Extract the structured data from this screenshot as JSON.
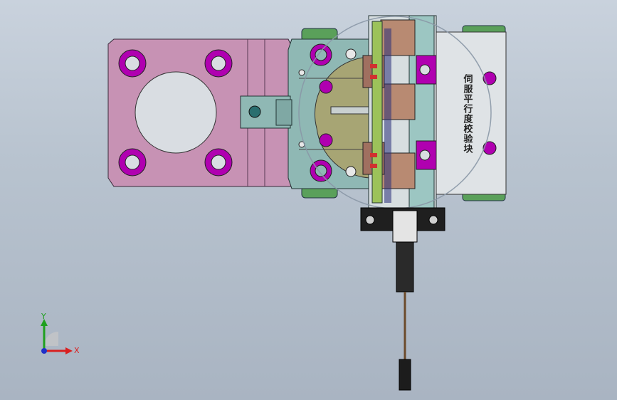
{
  "viewport": {
    "part_label": "伺服平行度校验块",
    "colors": {
      "background_top": "#c9d2dd",
      "background_bottom": "#a9b4c2",
      "mount_plate": "#c792b4",
      "mount_bore": "#d9dde2",
      "bolt_head": "#b000b0",
      "bracket": "#8fb8b4",
      "guide_block": "#d7dee0",
      "rail": "#5aa05a",
      "flange": "#a7a574",
      "connector_body": "#b88a72",
      "connector_green": "#9cc25a",
      "cable": "#6b4a2a",
      "cable_plug": "#1c1c1c"
    }
  },
  "triad": {
    "x_label": "X",
    "y_label": "Y",
    "x_color": "#d92020",
    "y_color": "#1fa01f",
    "z_color": "#2030c8"
  }
}
